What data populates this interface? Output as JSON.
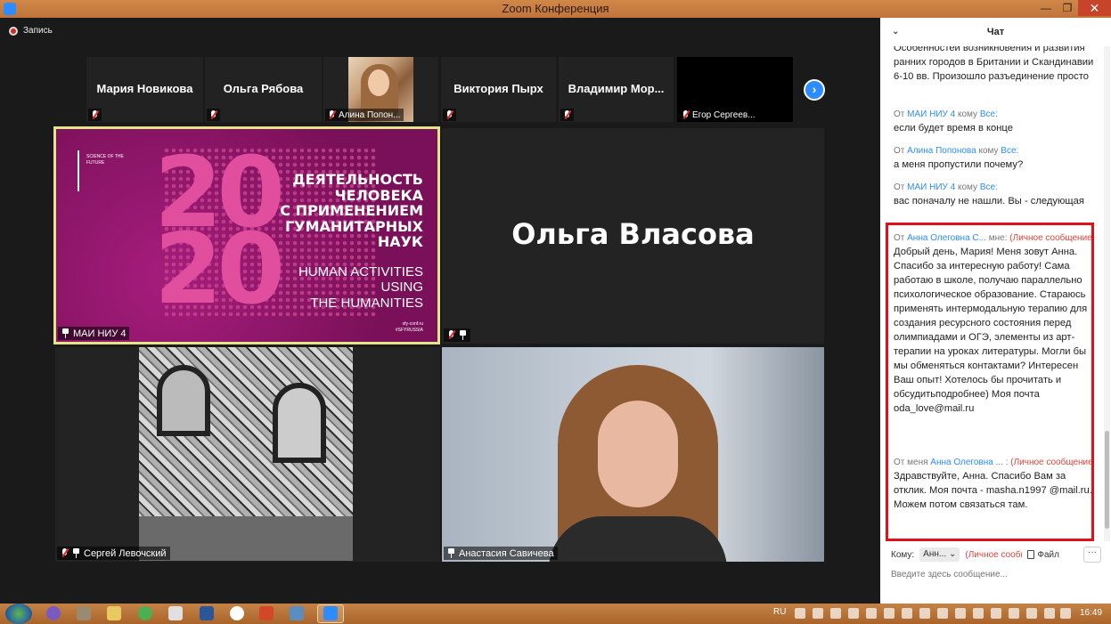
{
  "window": {
    "title": "Zoom Конференция",
    "min": "—",
    "max": "❐",
    "close": "✕"
  },
  "recording": {
    "label": "Запись"
  },
  "strip": [
    {
      "name": "Мария Новикова",
      "label": ""
    },
    {
      "name": "Ольга Рябова",
      "label": ""
    },
    {
      "name": "",
      "label": "Алина Попон..."
    },
    {
      "name": "Виктория Пырх",
      "label": ""
    },
    {
      "name": "Владимир  Мор...",
      "label": ""
    },
    {
      "name": "",
      "label": "Егор Сергеев..."
    }
  ],
  "tiles": {
    "slide_owner": "МАИ НИУ 4",
    "olga": "Ольга Власова",
    "sergey": "Сергей Левочский",
    "anastasia": "Анастасия Савичева"
  },
  "slide": {
    "year_top": "20",
    "year_bottom": "20",
    "logo_text": "SCIENCE OF THE FUTURE",
    "ru_line1": "ДЕЯТЕЛЬНОСТЬ",
    "ru_line2": "ЧЕЛОВЕКА",
    "ru_line3": "С ПРИМЕНЕНИЕМ",
    "ru_line4": "ГУМАНИТАРНЫХ",
    "ru_line5": "НАУК",
    "en_line1": "HUMAN ACTIVITIES",
    "en_line2": "USING",
    "en_line3": "THE HUMANITIES",
    "foot1": "sfy-conf.ru",
    "foot2": "#SFYRUSSIA"
  },
  "chat": {
    "title": "Чат",
    "messages": [
      {
        "from": "",
        "to": "",
        "priv": "",
        "text": "Особенностей возникновения и развития ранних городов в Британии и Скандинавии 6-10 вв. Произошло разъединение просто",
        "prefix": "",
        "mid": ""
      },
      {
        "prefix": "От",
        "from": "МАИ НИУ 4",
        "mid": "кому",
        "to": "Все:",
        "priv": "",
        "text": "если будет время в конце"
      },
      {
        "prefix": "От",
        "from": "Алина Попонова",
        "mid": "кому",
        "to": "Все:",
        "priv": "",
        "text": "а меня пропустили почему?"
      },
      {
        "prefix": "От",
        "from": "МАИ НИУ 4",
        "mid": "кому",
        "to": "Все:",
        "priv": "",
        "text": "вас поначалу не нашли. Вы - следующая"
      },
      {
        "prefix": "От",
        "from": "Анна Олеговна С...",
        "mid": "мне:",
        "to": "",
        "priv": "(Личное сообщение)",
        "text": "Добрый день, Мария!  Меня зовут Анна. Спасибо за интересную работу! Сама работаю в школе, получаю параллельно психологическое образование. Стараюсь применять интермодальную терапию для создания ресурсного состояния перед олимпиадами и ОГЭ, элементы из арт-терапии на уроках литературы. Могли бы мы обменяться контактами? Интересен Ваш опыт! Хотелось бы прочитать и обсудитьподробнее) Моя почта oda_love@mail.ru"
      },
      {
        "prefix": "От меня",
        "from": "Анна Олеговна ...",
        "mid": ":",
        "to": "",
        "priv": "(Личное сообщение)",
        "text": "Здравствуйте, Анна. Спасибо Вам за отклик. Моя почта - masha.n1997 @mail.ru. Можем потом связаться там."
      }
    ],
    "to_label": "Кому:",
    "to_value": "Анн... ⌄",
    "to_priv": "(Личное сообщение)",
    "file_label": "Файл",
    "more": "···",
    "input_placeholder": "Введите здесь сообщение..."
  },
  "taskbar": {
    "lang": "RU",
    "time": "16:49"
  }
}
